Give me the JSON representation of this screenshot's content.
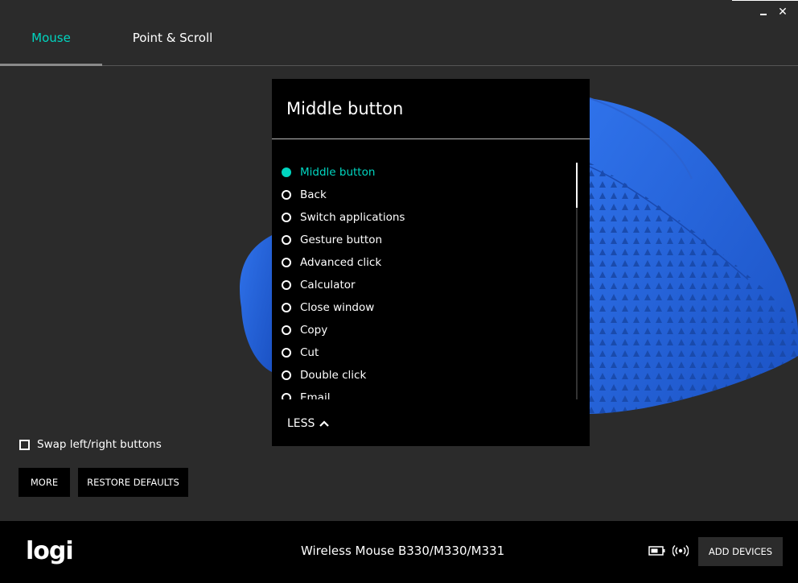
{
  "window": {
    "close_glyph": "✕"
  },
  "tabs": [
    {
      "label": "Mouse",
      "active": true
    },
    {
      "label": "Point & Scroll",
      "active": false
    }
  ],
  "panel": {
    "title": "Middle button",
    "selected_index": 0,
    "options": [
      "Middle button",
      "Back",
      "Switch applications",
      "Gesture button",
      "Advanced click",
      "Calculator",
      "Close window",
      "Copy",
      "Cut",
      "Double click",
      "Email"
    ],
    "less_label": "LESS"
  },
  "settings": {
    "swap_label": "Swap left/right buttons",
    "swap_checked": false,
    "more_label": "MORE",
    "restore_label": "RESTORE DEFAULTS"
  },
  "footer": {
    "logo": "logi",
    "device_name": "Wireless Mouse B330/M330/M331",
    "add_devices_label": "ADD DEVICES"
  },
  "colors": {
    "accent": "#00d5c0",
    "background": "#2b2b2b",
    "mouse_blue": "#1f5fd6"
  },
  "icons": [
    "minimize-icon",
    "close-icon",
    "chevron-up-icon",
    "battery-icon",
    "wireless-signal-icon"
  ]
}
